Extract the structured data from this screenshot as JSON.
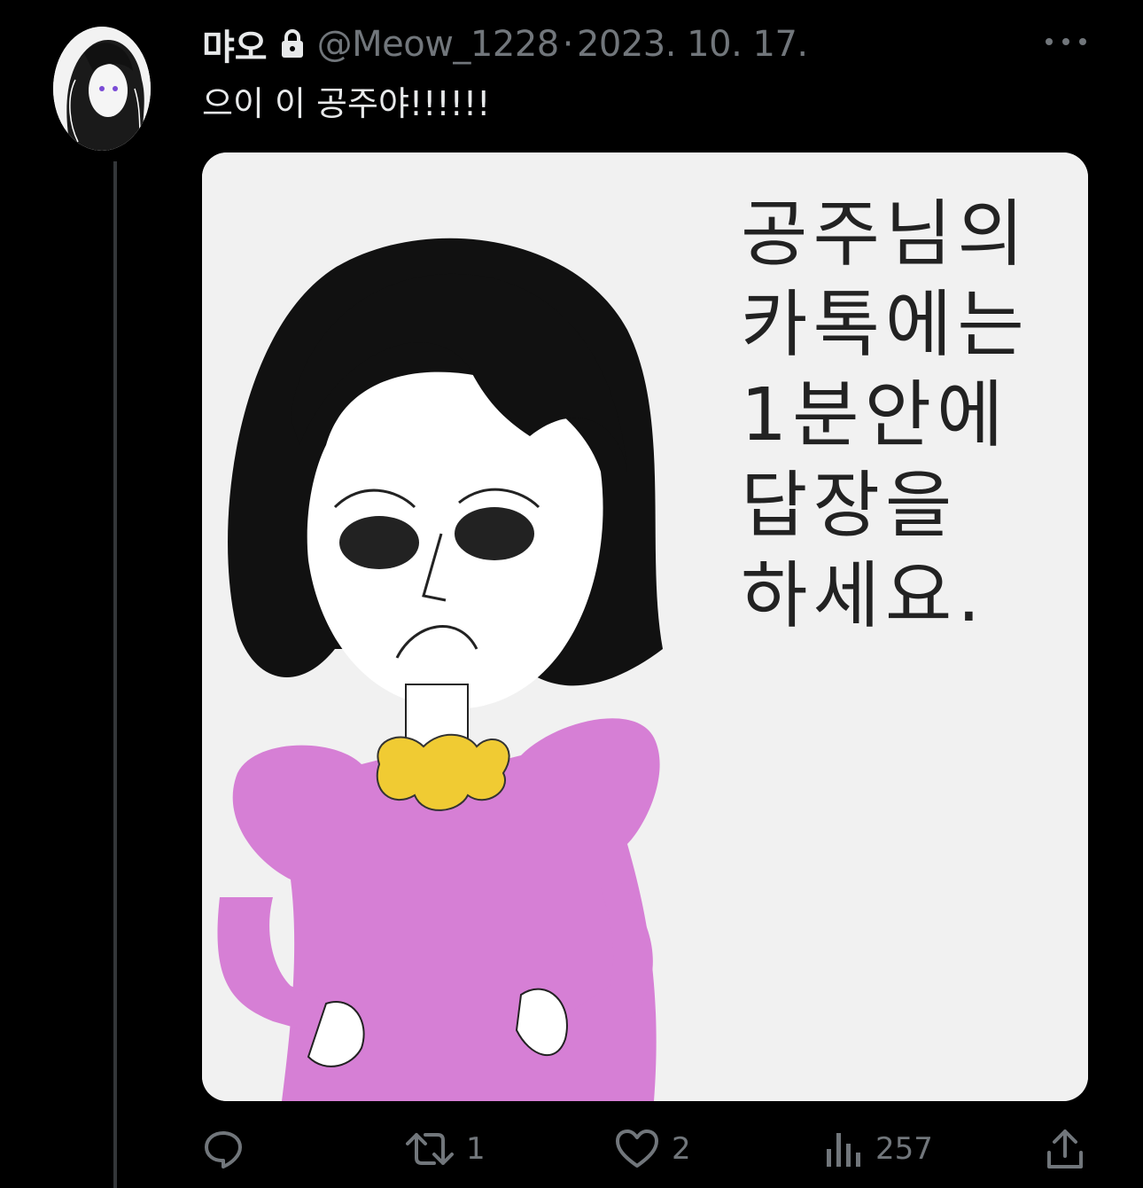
{
  "tweet": {
    "display_name": "먀오",
    "handle": "@Meow_1228",
    "separator": "·",
    "date": "2023. 10. 17.",
    "text": "으이 이 공주야!!!!!!"
  },
  "media": {
    "comic_lines": [
      "공주님의",
      "카톡에는",
      "1분안에",
      "답장을",
      "하세요."
    ]
  },
  "actions": {
    "reply_icon": "reply-icon",
    "retweet_count": "1",
    "like_count": "2",
    "views_count": "257"
  },
  "colors": {
    "background": "#000000",
    "text": "#e7e9ea",
    "muted": "#71767b",
    "dress": "#d67fd5",
    "collar": "#f0cb33"
  }
}
